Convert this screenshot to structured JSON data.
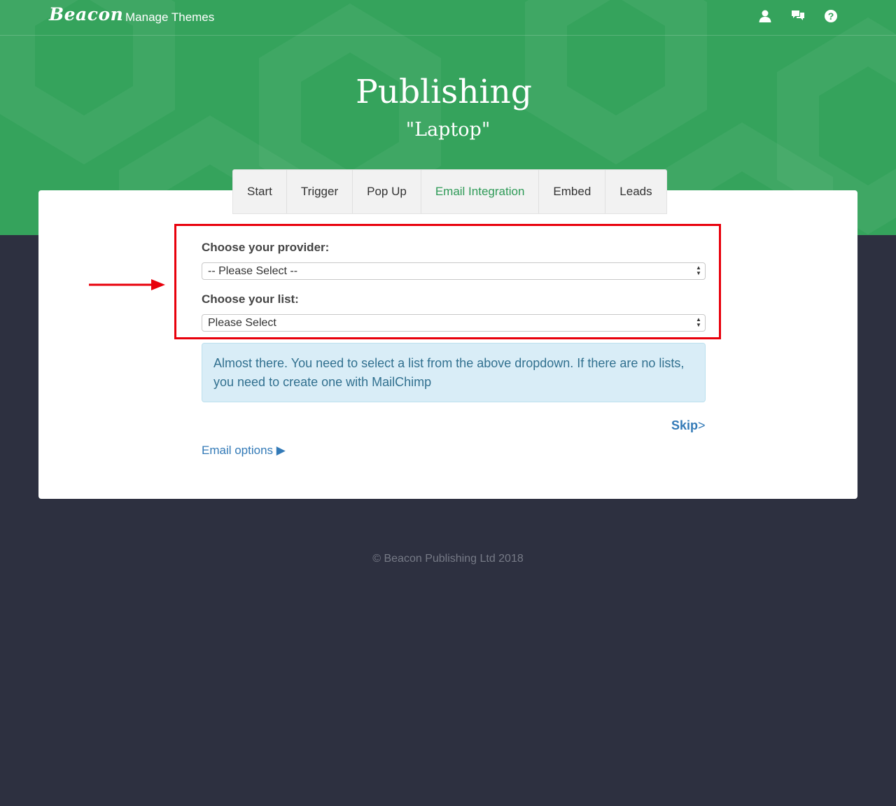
{
  "navbar": {
    "logo_text": "Beacon",
    "manage_themes_label": "Manage Themes",
    "icons": [
      "user-icon",
      "comments-icon",
      "help-icon"
    ]
  },
  "hero": {
    "title": "Publishing",
    "subtitle": "\"Laptop\"",
    "background_color": "#35a35c"
  },
  "tabs": {
    "items": [
      {
        "label": "Start",
        "active": false
      },
      {
        "label": "Trigger",
        "active": false
      },
      {
        "label": "Pop Up",
        "active": false
      },
      {
        "label": "Email Integration",
        "active": true
      },
      {
        "label": "Embed",
        "active": false
      },
      {
        "label": "Leads",
        "active": false
      }
    ],
    "active_color": "#2e9a57"
  },
  "form": {
    "provider_label": "Choose your provider:",
    "provider_value": "-- Please Select --",
    "list_label": "Choose your list:",
    "list_value": "Please Select",
    "highlight_color": "#e8000b"
  },
  "alert": {
    "text": "Almost there. You need to select a list from the above dropdown. If there are no lists, you need to create one with MailChimp"
  },
  "actions": {
    "skip_label": "Skip",
    "skip_suffix": ">",
    "email_options_label": "Email options ▶"
  },
  "footer": {
    "copyright": "© Beacon Publishing Ltd 2018"
  }
}
